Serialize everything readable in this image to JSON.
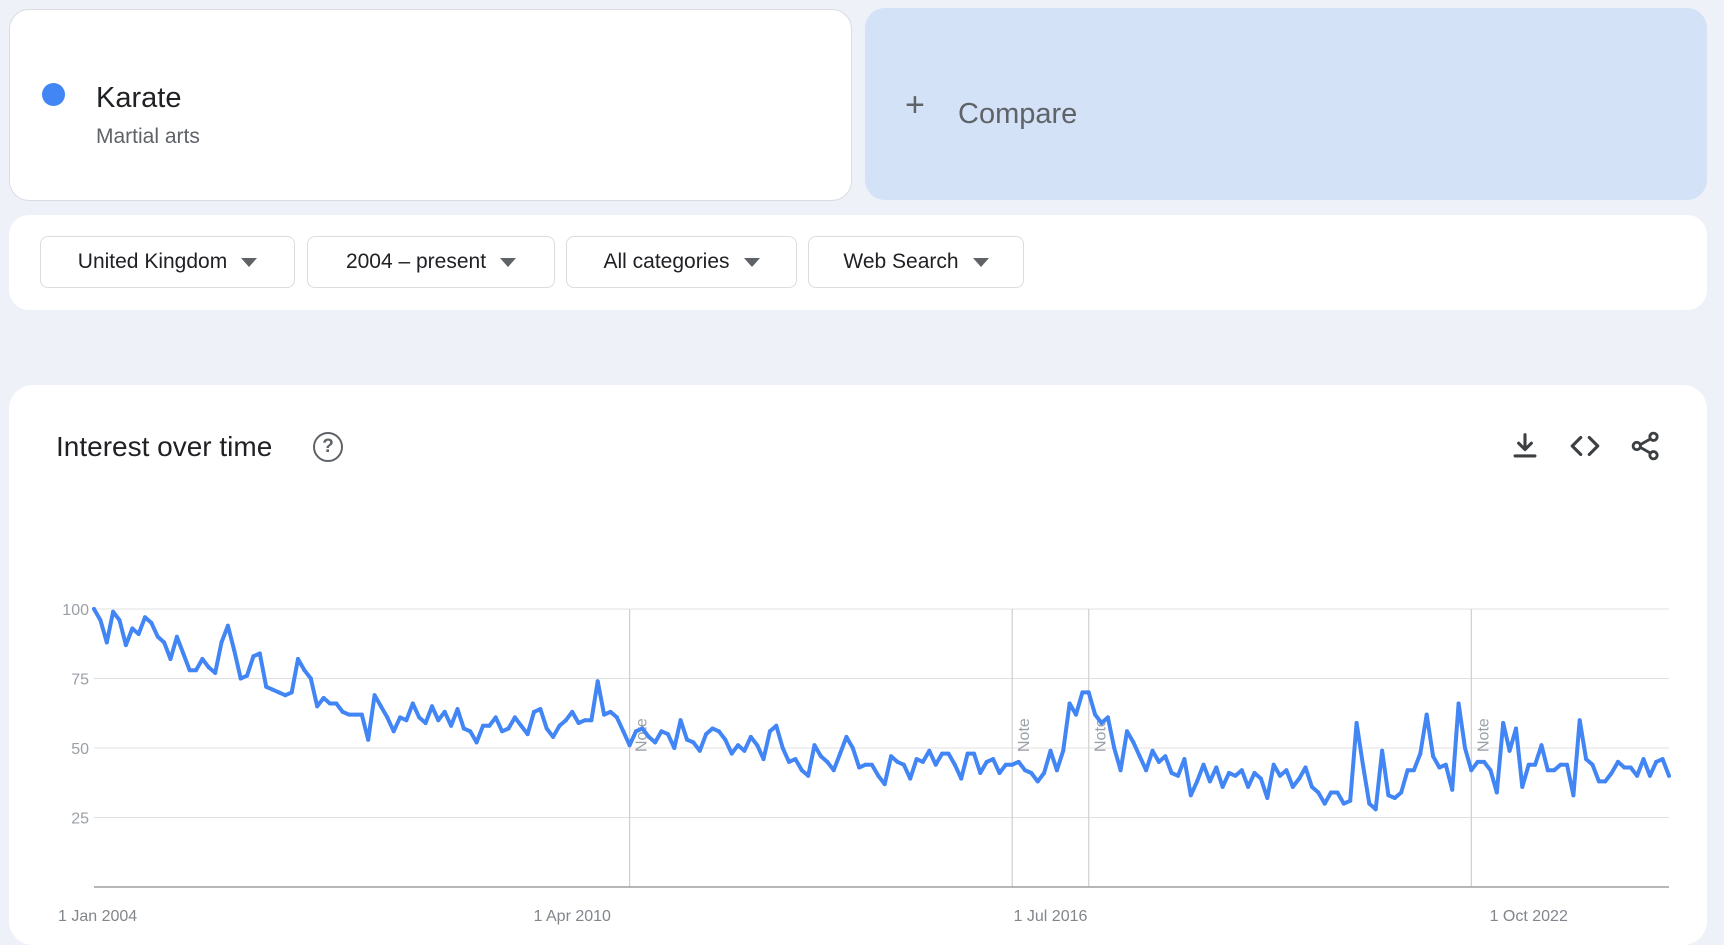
{
  "term": {
    "name": "Karate",
    "subtitle": "Martial arts",
    "color": "#4285f4"
  },
  "compare": {
    "plus": "+",
    "label": "Compare"
  },
  "filters": {
    "region": "United Kingdom",
    "time": "2004 – present",
    "category": "All categories",
    "search_type": "Web Search"
  },
  "panel": {
    "title": "Interest over time",
    "help_icon": "help-circle-icon",
    "tools": [
      "download-icon",
      "embed-code-icon",
      "share-icon"
    ]
  },
  "chart_data": {
    "type": "line",
    "title": "",
    "xlabel": "",
    "ylabel": "",
    "ylim": [
      0,
      100
    ],
    "yticks": [
      25,
      50,
      75,
      100
    ],
    "grid": true,
    "x_tick_labels": [
      "1 Jan 2004",
      "1 Apr 2010",
      "1 Jul 2016",
      "1 Oct 2022"
    ],
    "x_tick_dates": [
      "2004-01",
      "2010-04",
      "2016-07",
      "2022-10"
    ],
    "annotations": [
      {
        "date": "2011-01",
        "text": "Note"
      },
      {
        "date": "2016-01",
        "text": "Note"
      },
      {
        "date": "2017-01",
        "text": "Note"
      },
      {
        "date": "2022-01",
        "text": "Note"
      }
    ],
    "series": [
      {
        "name": "Karate",
        "color": "#4285f4",
        "start": "2004-01",
        "frequency": "monthly",
        "values": [
          100,
          96,
          88,
          99,
          96,
          87,
          93,
          91,
          97,
          95,
          90,
          88,
          82,
          90,
          84,
          78,
          78,
          82,
          79,
          77,
          88,
          94,
          85,
          75,
          76,
          83,
          84,
          72,
          71,
          70,
          69,
          70,
          82,
          78,
          75,
          65,
          68,
          66,
          66,
          63,
          62,
          62,
          62,
          53,
          69,
          65,
          61,
          56,
          61,
          60,
          66,
          61,
          59,
          65,
          60,
          63,
          58,
          64,
          57,
          56,
          52,
          58,
          58,
          61,
          56,
          57,
          61,
          58,
          55,
          63,
          64,
          57,
          54,
          58,
          60,
          63,
          59,
          60,
          60,
          74,
          62,
          63,
          61,
          56,
          51,
          56,
          57,
          54,
          52,
          56,
          55,
          50,
          60,
          53,
          52,
          49,
          55,
          57,
          56,
          53,
          48,
          51,
          49,
          54,
          51,
          46,
          56,
          58,
          50,
          45,
          46,
          42,
          40,
          51,
          47,
          45,
          42,
          48,
          54,
          50,
          43,
          44,
          44,
          40,
          37,
          47,
          45,
          44,
          39,
          46,
          45,
          49,
          44,
          48,
          48,
          44,
          39,
          48,
          48,
          41,
          45,
          46,
          41,
          44,
          44,
          45,
          42,
          41,
          38,
          41,
          49,
          42,
          49,
          66,
          62,
          70,
          70,
          62,
          59,
          61,
          50,
          42,
          56,
          52,
          47,
          42,
          49,
          45,
          47,
          41,
          40,
          46,
          33,
          38,
          44,
          38,
          43,
          36,
          41,
          40,
          42,
          36,
          41,
          39,
          32,
          44,
          40,
          42,
          36,
          39,
          43,
          36,
          34,
          30,
          34,
          34,
          30,
          31,
          59,
          44,
          30,
          28,
          49,
          33,
          32,
          34,
          42,
          42,
          48,
          62,
          47,
          43,
          44,
          35,
          66,
          50,
          42,
          45,
          45,
          42,
          34,
          59,
          49,
          57,
          36,
          44,
          44,
          51,
          42,
          42,
          44,
          44,
          33,
          60,
          46,
          44,
          38,
          38,
          41,
          45,
          43,
          43,
          40,
          46,
          40,
          45,
          46,
          40
        ]
      }
    ]
  }
}
